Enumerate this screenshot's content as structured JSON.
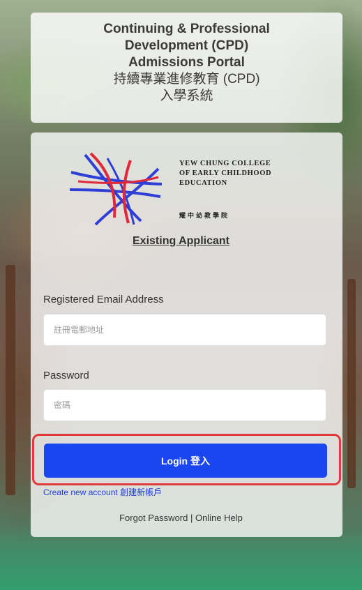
{
  "header": {
    "title_en_line1": "Continuing & Professional",
    "title_en_line2": "Development (CPD)",
    "title_en_line3": "Admissions Portal",
    "title_zh_line1": "持續專業進修教育 (CPD)",
    "title_zh_line2": "入學系統"
  },
  "logo": {
    "college_line1": "YEW CHUNG COLLEGE",
    "college_line2": "OF EARLY CHILDHOOD",
    "college_line3": "EDUCATION",
    "college_zh": "耀中幼教學院"
  },
  "form": {
    "heading": "Existing Applicant",
    "email_label": "Registered Email Address",
    "email_placeholder": "註冊電郵地址",
    "password_label": "Password",
    "password_placeholder": "密碼",
    "login_label": "Login 登入"
  },
  "links": {
    "create_account": "Create new account 創建新帳戶",
    "forgot_password": "Forgot Password",
    "separator": " | ",
    "online_help": "Online Help"
  },
  "colors": {
    "login_button": "#1a46f0",
    "highlight": "#e23a3a",
    "link": "#1d3fd8"
  }
}
